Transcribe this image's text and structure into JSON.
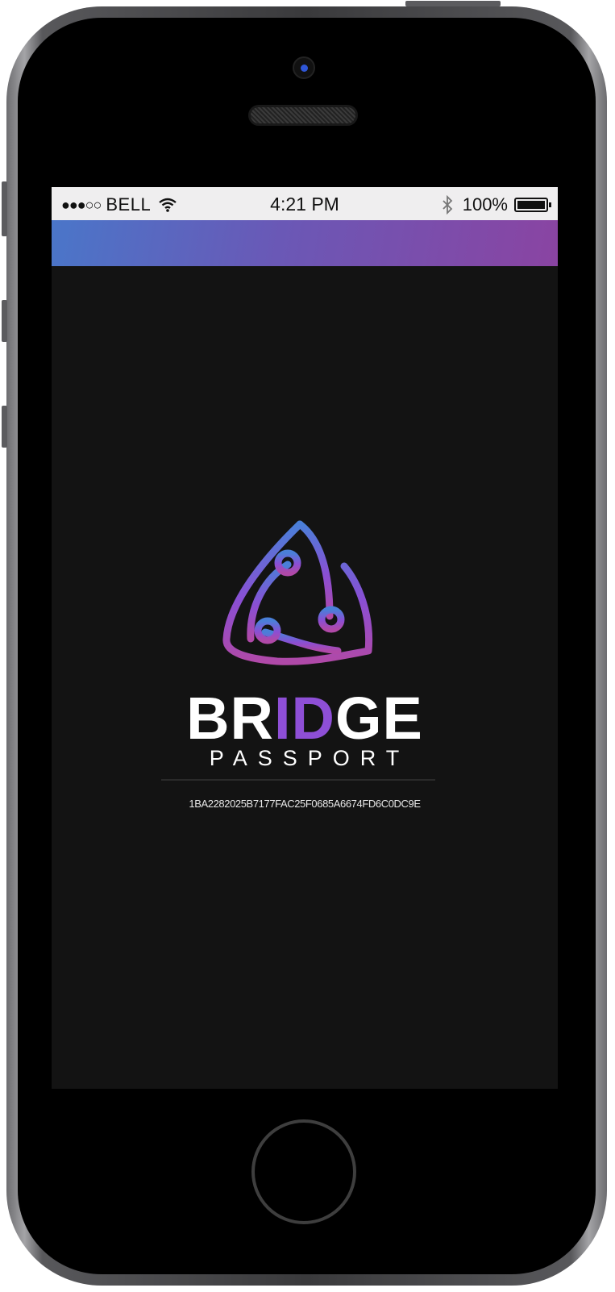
{
  "status_bar": {
    "signal_dots": "●●●○○",
    "carrier": "BELL",
    "wifi_icon": "wifi-icon",
    "time": "4:21 PM",
    "bluetooth_icon": "bluetooth-icon",
    "battery_percent": "100%",
    "battery_icon": "battery-icon"
  },
  "splash": {
    "brand_prefix": "BR",
    "brand_accent": "ID",
    "brand_suffix": "GE",
    "brand_subtitle": "PASSPORT",
    "device_id": "1BA2282025B7177FAC25F0685A6674FD6C0DC9E"
  },
  "colors": {
    "header_gradient_start": "#4a76c9",
    "header_gradient_end": "#8a44a2",
    "screen_background": "#131313",
    "accent": "#8e4fd6"
  }
}
